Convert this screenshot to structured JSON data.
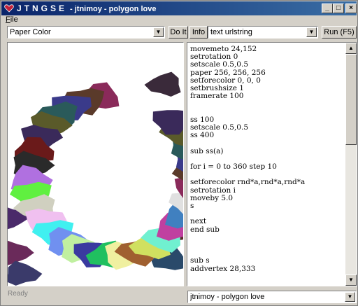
{
  "window": {
    "app_name": "JTNGSE",
    "title": "- jtnimoy - polygon love",
    "minimize": "_",
    "maximize": "□",
    "close": "×"
  },
  "menu": {
    "file_prefix": "F",
    "file_rest": "ile"
  },
  "toolbar": {
    "paper_select": "Paper Color",
    "do_it": "Do It",
    "info": "Info",
    "text_select": "text urlstring",
    "run": "Run (F5)"
  },
  "editor": {
    "code": "movemeto 24,152\nsetrotation 0\nsetscale 0.5,0.5\npaper 256, 256, 256\nsetforecolor 0, 0, 0\nsetbrushsize 1\nframerate 100\n\n\nss 100\nsetscale 0.5,0.5\nss 400\n\nsub ss(a)\n\nfor i = 0 to 360 step 10\n\nsetforecolor rnd*a,rnd*a,rnd*a\nsetrotation i\nmoveby 5.0\ns\n\nnext\nend sub\n\n\n\nsub s\naddvertex 28,333"
  },
  "status": {
    "text": "Ready"
  },
  "bottom": {
    "sketch_select": "jtnimoy - polygon love"
  },
  "colors": {
    "title_start": "#0a246a",
    "title_end": "#3a6ea5",
    "face": "#d4d0c8"
  }
}
